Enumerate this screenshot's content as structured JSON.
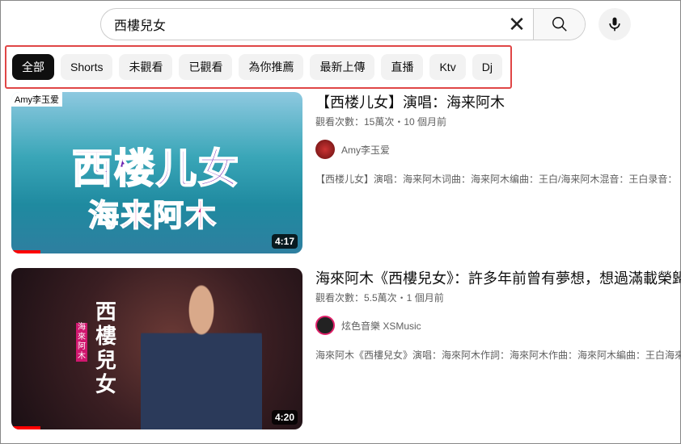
{
  "search": {
    "query": "西樓兒女"
  },
  "chips": [
    "全部",
    "Shorts",
    "未觀看",
    "已觀看",
    "為你推薦",
    "最新上傳",
    "直播",
    "Ktv",
    "Dj"
  ],
  "videos": [
    {
      "thumb_label": "Amy李玉爱",
      "thumb_title": "西楼儿女",
      "thumb_sub": "海来阿木",
      "duration": "4:17",
      "progress": 0.1,
      "title": "【西楼儿女】演唱：海来阿木",
      "meta": "觀看次數：15萬次・10 個月前",
      "channel": "Amy李玉爱",
      "description": "【西楼儿女】演唱：海来阿木词曲：海来阿木编曲：王白/海来阿木混音：王白录音："
    },
    {
      "thumb_title": "西樓兒女",
      "thumb_sub": "海來阿木",
      "duration": "4:20",
      "progress": 0.1,
      "title": "海來阿木《西樓兒女》：許多年前曾有夢想，想過滿載榮歸",
      "meta": "觀看次數：5.5萬次・1 個月前",
      "channel": "炫色音樂 XSMusic",
      "description": "海來阿木《西樓兒女》演唱：海來阿木作詞：海來阿木作曲：海來阿木編曲：王白海來阿木"
    }
  ]
}
